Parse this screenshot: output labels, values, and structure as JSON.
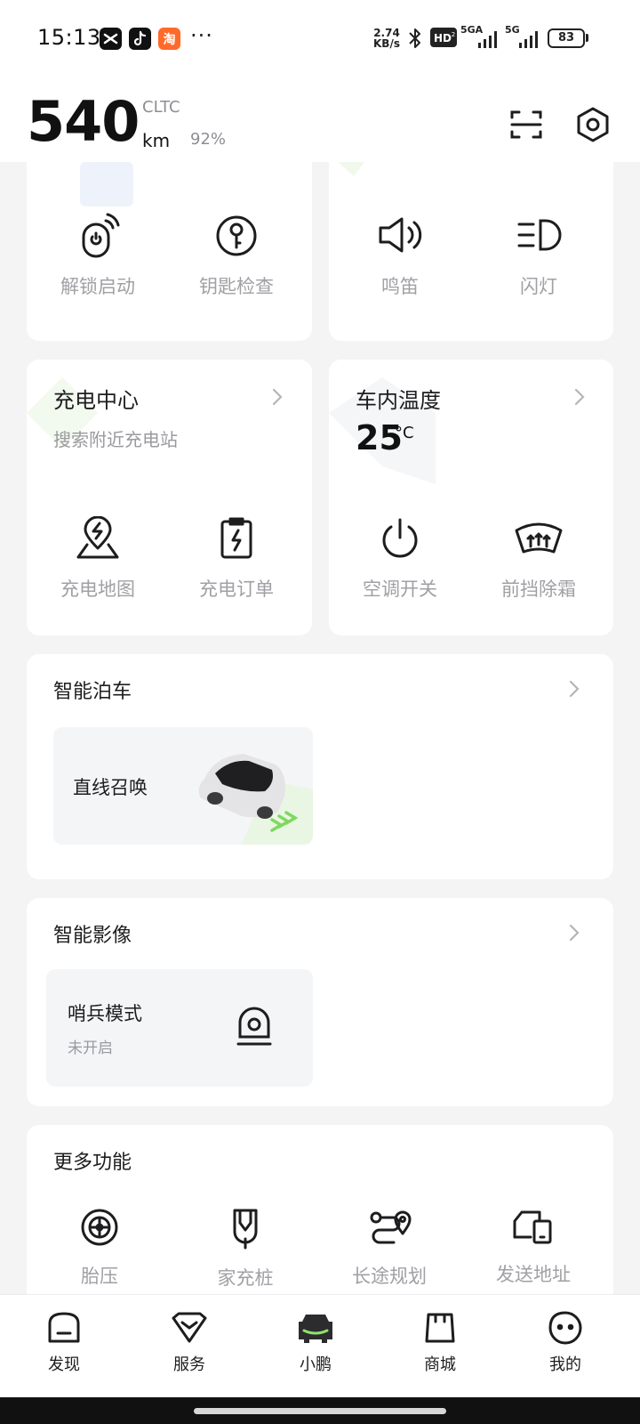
{
  "status_bar": {
    "time": "15:13",
    "app_icons": [
      "capcut-icon",
      "tiktok-icon",
      "taobao-icon"
    ],
    "more": "···",
    "speed_value": "2.74",
    "speed_unit": "KB/s",
    "network_1": "5GA",
    "network_2": "5G",
    "battery": "83"
  },
  "header": {
    "range_value": "540",
    "range_standard": "CLTC",
    "range_unit": "km",
    "battery_percent": "92%",
    "scan_icon": "scan-icon",
    "settings_icon": "hexagon-settings-icon"
  },
  "quick_controls": {
    "left": [
      {
        "label": "解锁启动",
        "icon": "unlock-start-icon"
      },
      {
        "label": "钥匙检查",
        "icon": "key-check-icon"
      }
    ],
    "right": [
      {
        "label": "鸣笛",
        "icon": "horn-icon"
      },
      {
        "label": "闪灯",
        "icon": "flash-light-icon"
      }
    ]
  },
  "charging": {
    "title": "充电中心",
    "subtitle": "搜索附近充电站",
    "actions": [
      {
        "label": "充电地图",
        "icon": "charge-map-icon"
      },
      {
        "label": "充电订单",
        "icon": "charge-order-icon"
      }
    ]
  },
  "climate": {
    "title": "车内温度",
    "temperature": "25",
    "temperature_unit": "°C",
    "actions": [
      {
        "label": "空调开关",
        "icon": "power-icon"
      },
      {
        "label": "前挡除霜",
        "icon": "defrost-icon"
      }
    ]
  },
  "parking": {
    "title": "智能泊车",
    "feature_label": "直线召唤",
    "image": "car-summon-illustration"
  },
  "imaging": {
    "title": "智能影像",
    "mode_label": "哨兵模式",
    "mode_status": "未开启",
    "icon": "sentry-camera-icon"
  },
  "more_functions": {
    "title": "更多功能",
    "items": [
      {
        "label": "胎压",
        "icon": "tire-pressure-icon"
      },
      {
        "label": "家充桩",
        "icon": "home-charger-icon"
      },
      {
        "label": "长途规划",
        "icon": "route-plan-icon"
      },
      {
        "label": "发送地址",
        "icon": "send-address-icon"
      }
    ]
  },
  "bottom_nav": {
    "items": [
      {
        "label": "发现",
        "icon": "discover-icon"
      },
      {
        "label": "服务",
        "icon": "service-icon"
      },
      {
        "label": "小鹏",
        "icon": "car-icon"
      },
      {
        "label": "商城",
        "icon": "mall-icon"
      },
      {
        "label": "我的",
        "icon": "profile-icon"
      }
    ],
    "active": "小鹏"
  },
  "colors": {
    "accent_green": "#8ee26b",
    "text_primary": "#1d1d1f",
    "text_secondary": "#9a9a9e",
    "background": "#f4f4f5",
    "card": "#ffffff"
  }
}
